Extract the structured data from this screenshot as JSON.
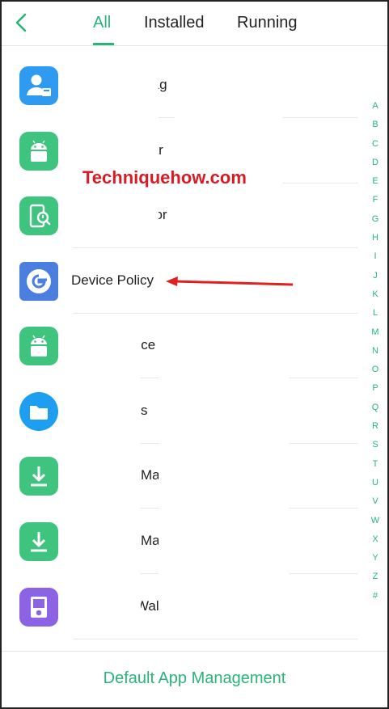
{
  "header": {
    "back_icon": "chevron-left-icon",
    "tabs": [
      {
        "label": "All",
        "active": true
      },
      {
        "label": "Installed",
        "active": false
      },
      {
        "label": "Running",
        "active": false
      }
    ],
    "accent_color": "#28b47a"
  },
  "apps": [
    {
      "name": "rag",
      "icon": "contact-storage-icon"
    },
    {
      "name": "tar",
      "icon": "android-icon"
    },
    {
      "name": "hor",
      "icon": "phone-inspect-icon"
    },
    {
      "name": "Device Policy",
      "icon": "google-device-policy-icon"
    },
    {
      "name": "vice",
      "icon": "android-icon"
    },
    {
      "name": "s",
      "icon": "folder-icon"
    },
    {
      "name": "Ma",
      "icon": "download-icon"
    },
    {
      "name": "Ma",
      "icon": "download-icon"
    },
    {
      "name": "Wal",
      "icon": "wallpaper-icon"
    }
  ],
  "alpha_index": [
    "A",
    "B",
    "C",
    "D",
    "E",
    "F",
    "G",
    "H",
    "I",
    "J",
    "K",
    "L",
    "M",
    "N",
    "O",
    "P",
    "Q",
    "R",
    "S",
    "T",
    "U",
    "V",
    "W",
    "X",
    "Y",
    "Z",
    "#"
  ],
  "watermark": "Techniquehow.com",
  "footer": {
    "label": "Default App Management"
  }
}
